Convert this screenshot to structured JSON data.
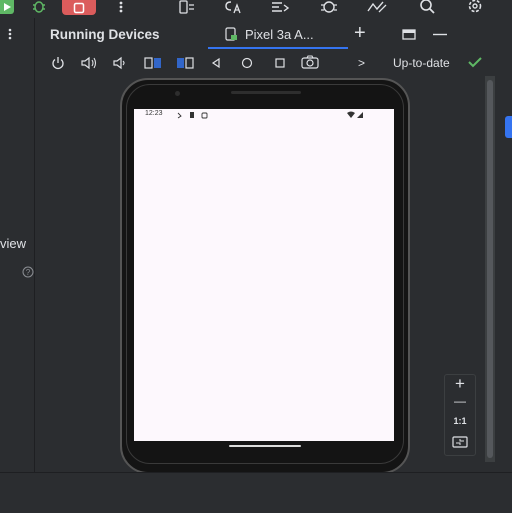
{
  "toolbar": {
    "icons": [
      "run-icon",
      "debug-icon",
      "stop-icon",
      "more-icon",
      "device-manager-icon",
      "translate-icon",
      "sync-icon",
      "profiler-icon",
      "app-quality-icon",
      "search-icon",
      "settings-icon"
    ]
  },
  "tool_window": {
    "title": "Running Devices",
    "tab_label": "Pixel 3a A...",
    "add_tab_label": "+",
    "status_label": "Up-to-date"
  },
  "left_panel": {
    "partial_label": "view"
  },
  "phone": {
    "status_time": "12:23"
  },
  "zoom_controls": {
    "zoom_in": "+",
    "zoom_out": "—",
    "actual_size": "1:1"
  },
  "device_toolbar": {
    "overflow_label": ">"
  },
  "colors": {
    "background": "#2b2d30",
    "accent": "#3574f0",
    "success": "#5fb865",
    "stop": "#db5c5c",
    "run": "#5fb865"
  }
}
